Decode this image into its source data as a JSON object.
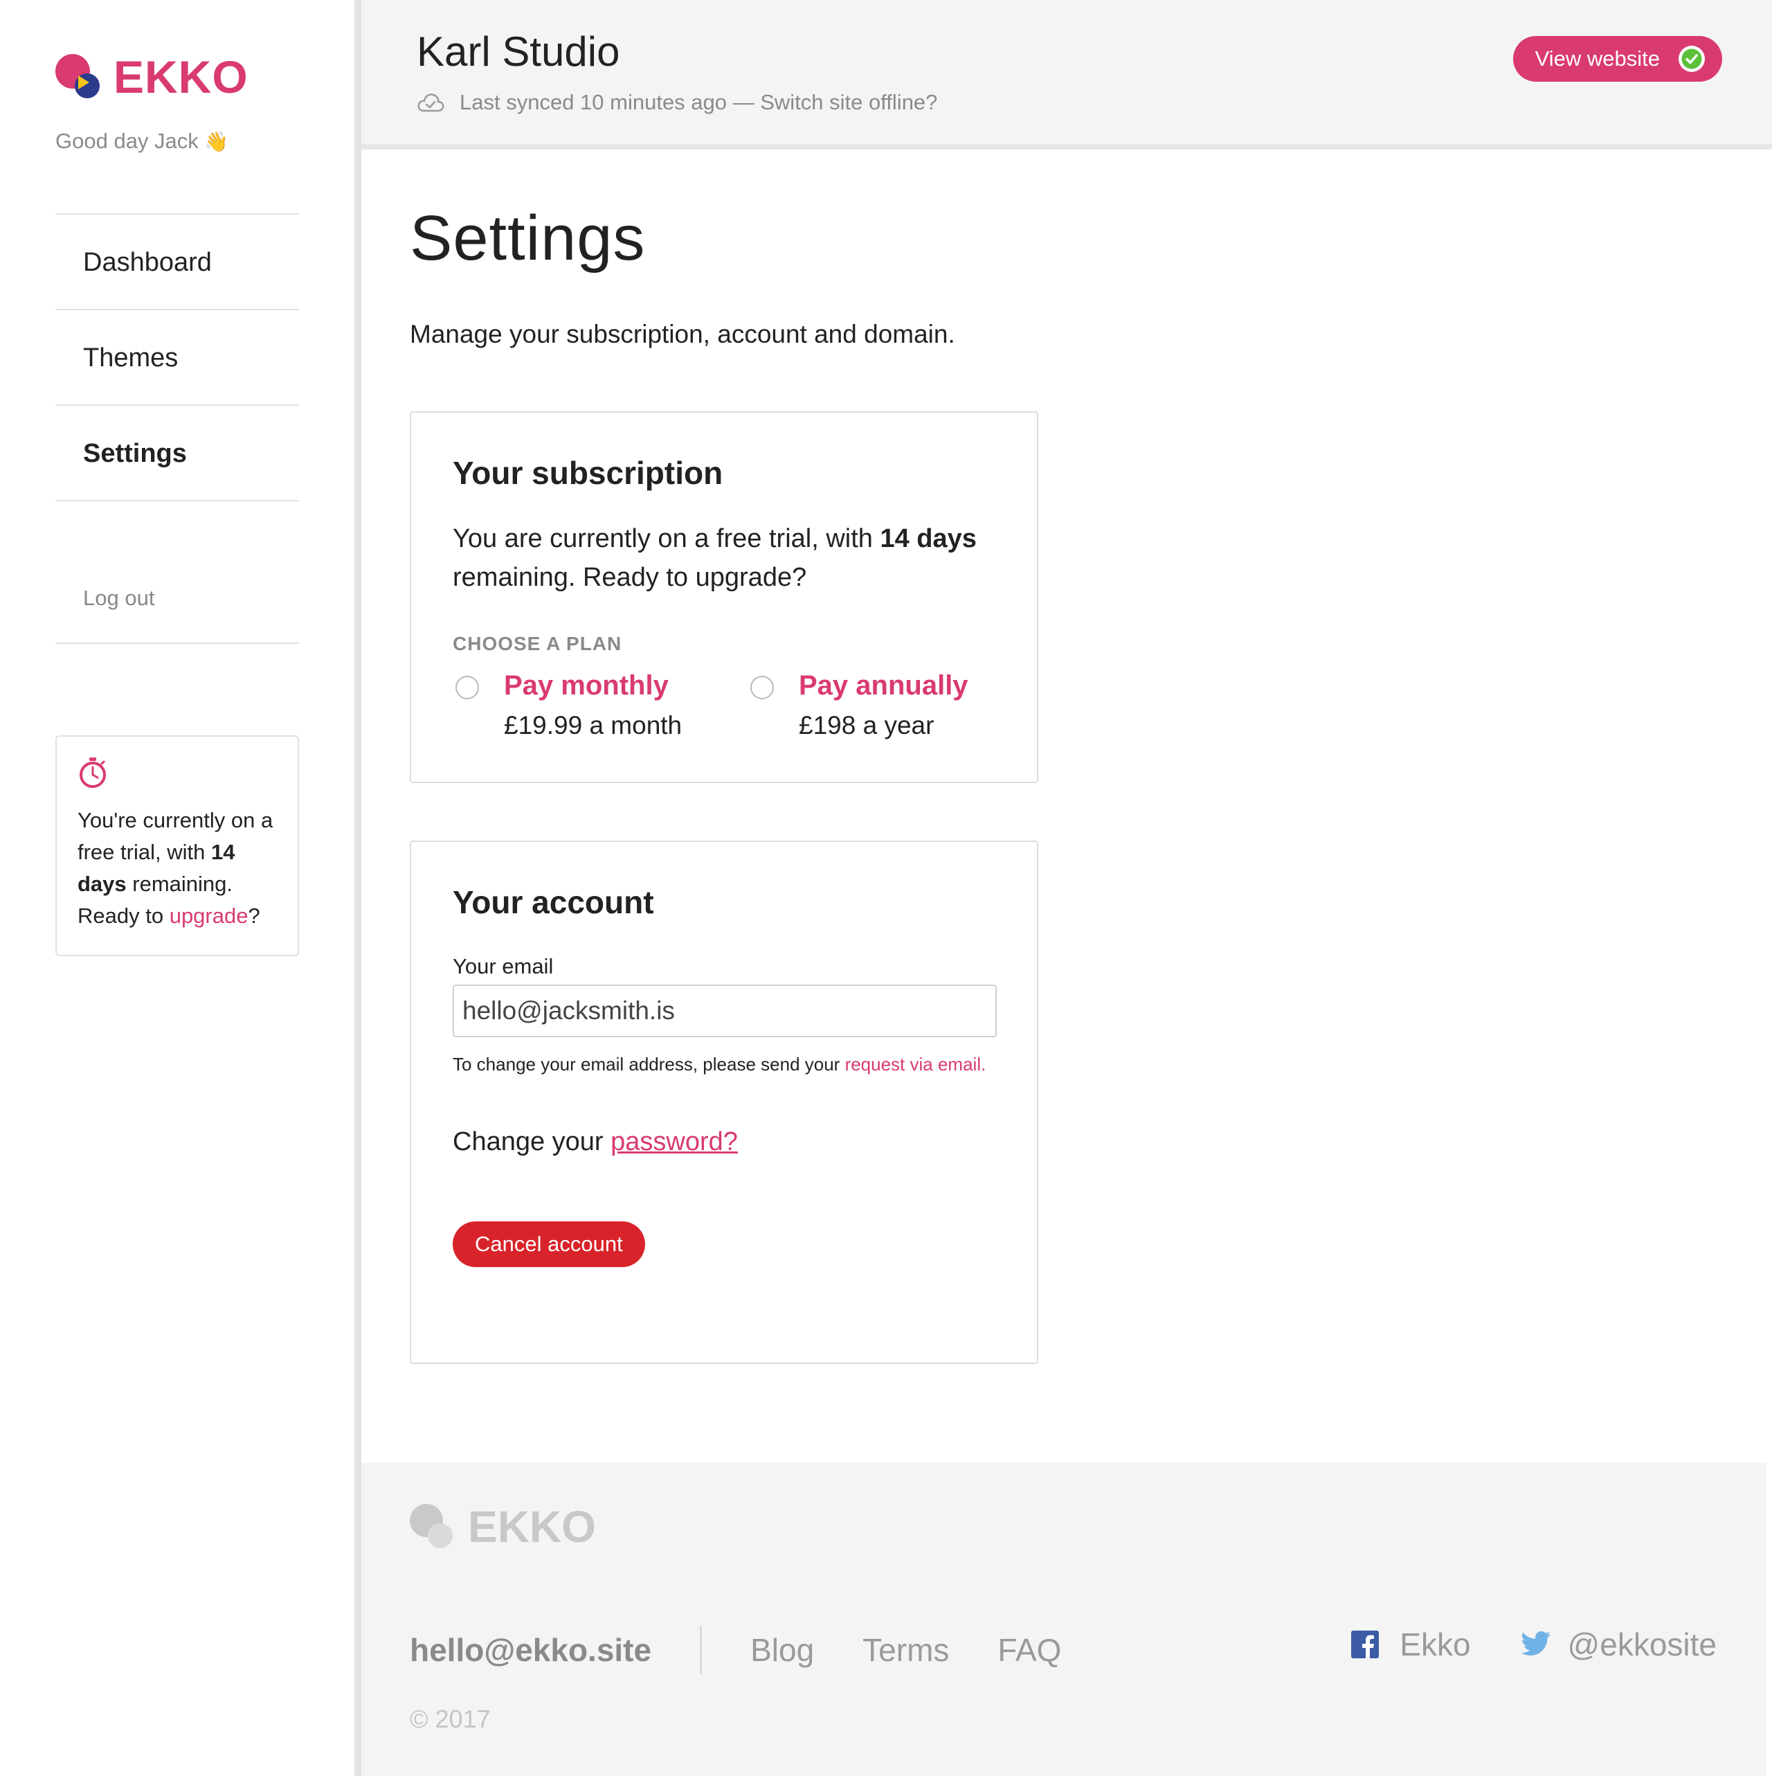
{
  "brand": {
    "name": "EKKO",
    "accent_color": "#d93a72"
  },
  "sidebar": {
    "greeting": "Good day Jack",
    "greeting_icon": "waving-hand-emoji",
    "nav": [
      {
        "label": "Dashboard",
        "active": false
      },
      {
        "label": "Themes",
        "active": false
      },
      {
        "label": "Settings",
        "active": true
      }
    ],
    "logout": "Log out",
    "trial_card": {
      "icon": "stopwatch-icon",
      "text_before": "You're currently on a free trial, with ",
      "days_bold": "14 days",
      "text_middle": " remaining. Ready to ",
      "link": "upgrade",
      "text_after": "?"
    }
  },
  "header": {
    "site_name": "Karl Studio",
    "sync_status": "Last synced 10 minutes ago — Switch site offline?",
    "view_website": "View website",
    "status_color": "#5cc03a"
  },
  "main": {
    "title": "Settings",
    "description": "Manage your subscription, account and domain.",
    "subscription": {
      "title": "Your subscription",
      "text_before": "You are currently on a free trial, with ",
      "days_bold": "14 days",
      "text_after": " remaining. Ready to upgrade?",
      "plan_label": "CHOOSE A PLAN",
      "plans": [
        {
          "name": "Pay monthly",
          "price": "£19.99 a month"
        },
        {
          "name": "Pay annually",
          "price": "£198 a year"
        }
      ]
    },
    "account": {
      "title": "Your account",
      "email_label": "Your email",
      "email_value": "hello@jacksmith.is",
      "note_before": "To change your email address, please send your ",
      "note_link": "request via email.",
      "password_prefix": "Change your ",
      "password_link": "password?",
      "cancel_button": "Cancel account",
      "cancel_color": "#d9232a"
    }
  },
  "footer": {
    "brand": "EKKO",
    "email": "hello@ekko.site",
    "links": [
      "Blog",
      "Terms",
      "FAQ"
    ],
    "facebook": "Ekko",
    "twitter": "@ekkosite",
    "copyright": "© 2017"
  }
}
